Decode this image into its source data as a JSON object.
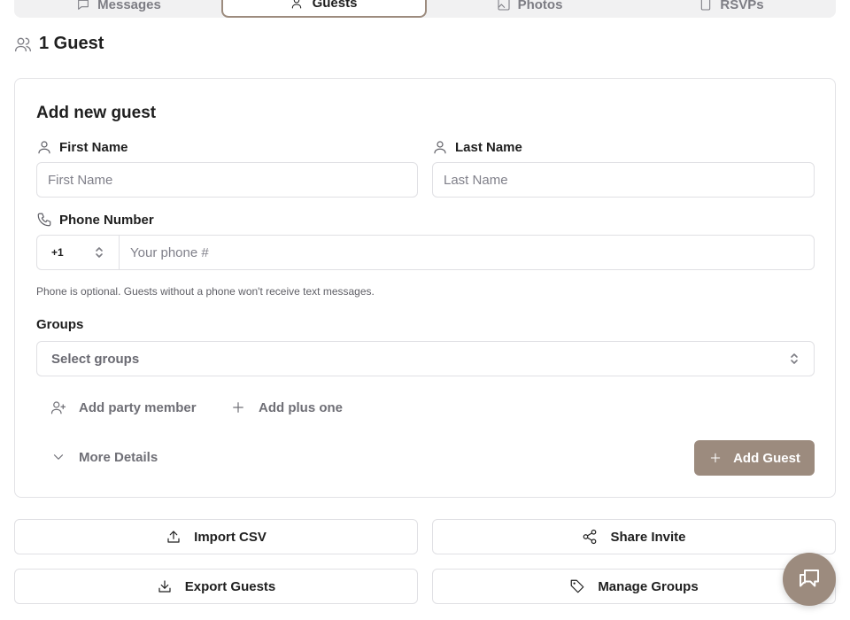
{
  "tabs": [
    {
      "label": "Messages",
      "icon": "message-icon",
      "active": false
    },
    {
      "label": "Guests",
      "icon": "users-icon",
      "active": true
    },
    {
      "label": "Photos",
      "icon": "image-icon",
      "active": false
    },
    {
      "label": "RSVPs",
      "icon": "clipboard-icon",
      "active": false
    }
  ],
  "header": {
    "title": "1 Guest",
    "icon": "users-icon"
  },
  "form": {
    "title": "Add new guest",
    "first_name": {
      "label": "First Name",
      "placeholder": "First Name",
      "value": ""
    },
    "last_name": {
      "label": "Last Name",
      "placeholder": "Last Name",
      "value": ""
    },
    "phone": {
      "label": "Phone Number",
      "country_code": "+1",
      "placeholder": "Your phone #",
      "value": ""
    },
    "phone_hint": "Phone is optional. Guests without a phone won't receive text messages.",
    "groups": {
      "label": "Groups",
      "placeholder": "Select groups"
    },
    "add_party_member": "Add party member",
    "add_plus_one": "Add plus one",
    "more_details": "More Details",
    "submit": "Add Guest"
  },
  "actions": {
    "import_csv": "Import CSV",
    "share_invite": "Share Invite",
    "export_guests": "Export Guests",
    "manage_groups": "Manage Groups"
  },
  "colors": {
    "accent": "#9c8b7e",
    "border": "#e0e0e4",
    "muted_text": "#6f6f76"
  }
}
